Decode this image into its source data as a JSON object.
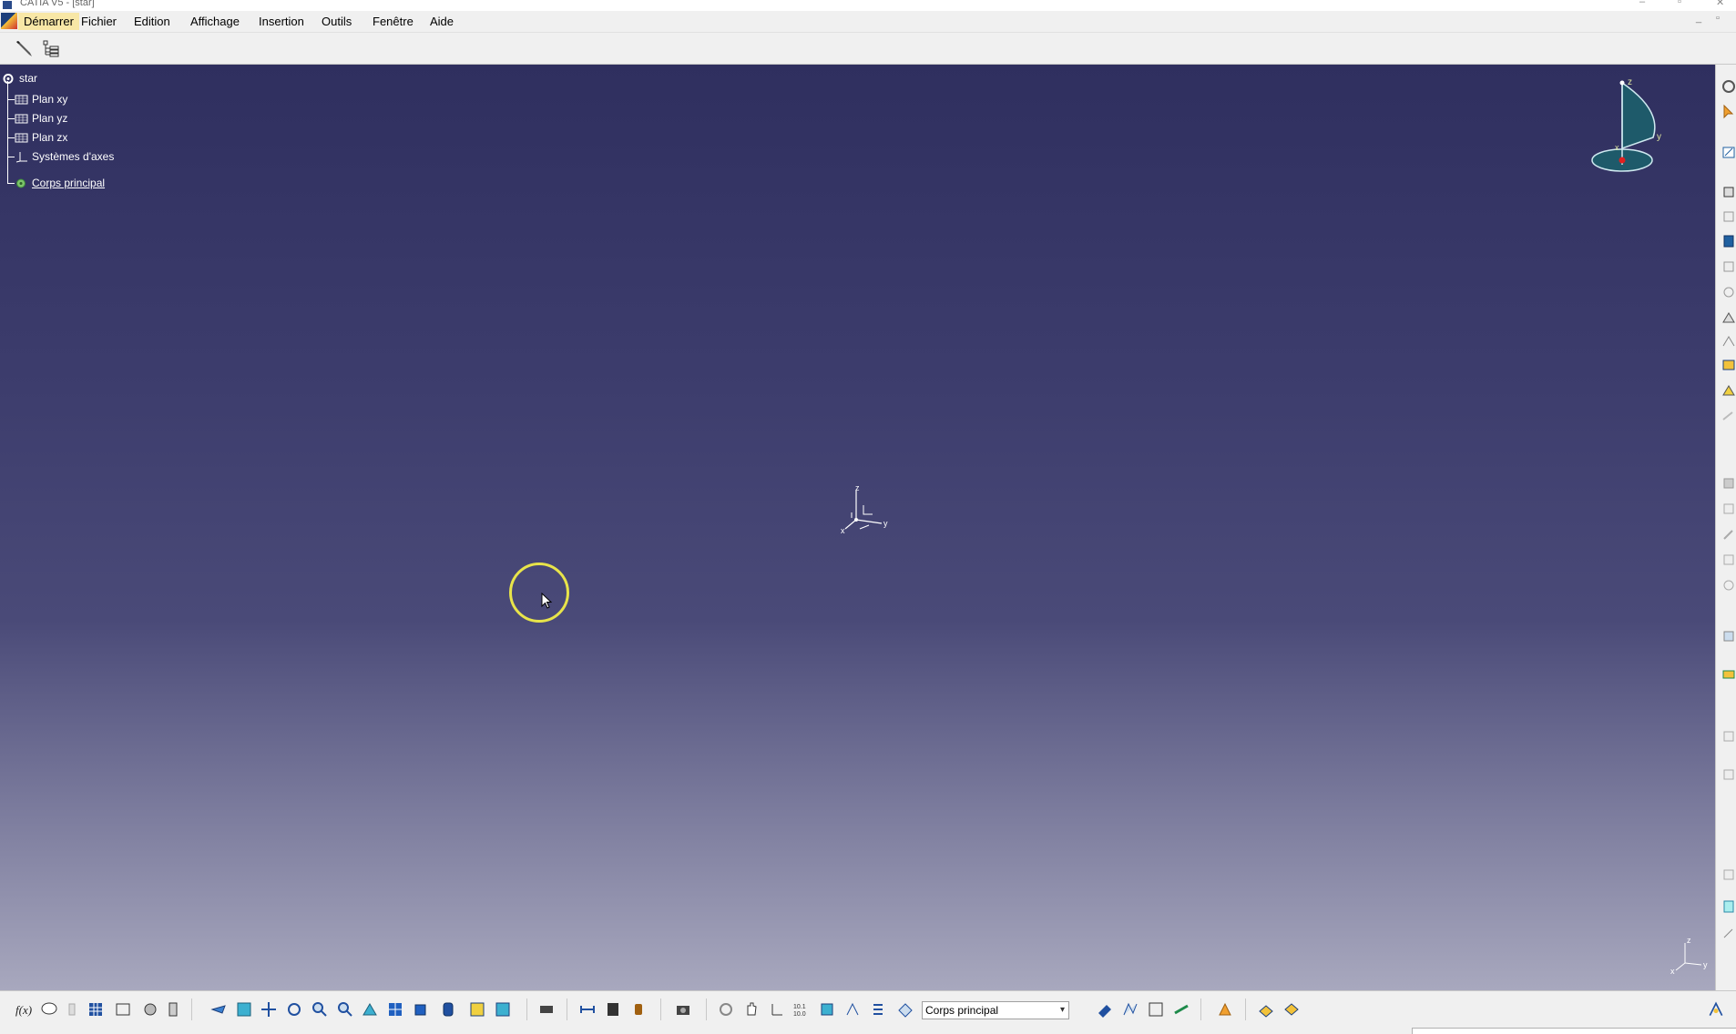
{
  "window": {
    "title": "CATIA V5 - [star]",
    "controls": {
      "minimize": "–",
      "restore": "▫",
      "close": "✕"
    }
  },
  "menubar": {
    "items": [
      "Démarrer",
      "Fichier",
      "Edition",
      "Affichage",
      "Insertion",
      "Outils",
      "Fenêtre",
      "Aide"
    ],
    "active_item": "Démarrer",
    "mdi_controls": {
      "minimize": "_",
      "restore": "▫"
    }
  },
  "toolbar_top": {
    "icons": [
      "sketch-pencil-icon",
      "tree-list-icon"
    ]
  },
  "tree": {
    "root": "star",
    "children": [
      "Plan xy",
      "Plan yz",
      "Plan zx",
      "Systèmes d'axes",
      "Corps principal"
    ]
  },
  "compass": {
    "labels": {
      "x": "x",
      "y": "y",
      "z": "z"
    }
  },
  "origin_axis": {
    "labels": {
      "x": "x",
      "y": "y",
      "z": "z"
    }
  },
  "corner_axis": {
    "labels": {
      "x": "x",
      "y": "y",
      "z": "z"
    }
  },
  "bottom_toolbar": {
    "body_selector": {
      "value": "Corps principal"
    }
  },
  "colors": {
    "viewport_top": "#2f2f5f",
    "viewport_bottom": "#a8a8be",
    "highlight_ring": "#e8e44a",
    "menu_active": "#f8e7a6"
  }
}
